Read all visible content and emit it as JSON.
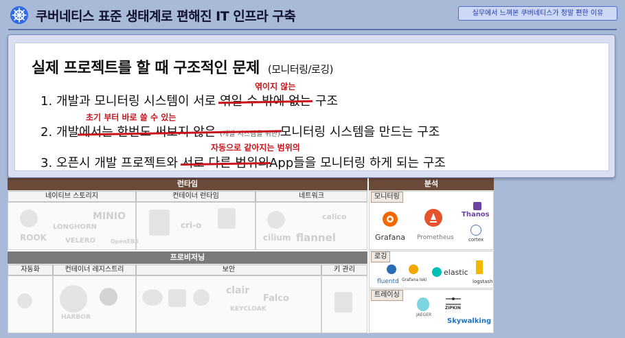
{
  "header": {
    "title": "쿠버네티스 표준 생태계로 편해진 IT 인프라 구축",
    "badge": "실무에서 느껴본 쿠버네티스가 정말 편한 이유",
    "logo_icon": "kubernetes-helm-icon"
  },
  "popup": {
    "title": "실제 프로젝트를 할 때 구조적인 문제",
    "subtitle": "(모니터링/로깅)",
    "lines": [
      {
        "num": "1.",
        "before": "개발과 모니터링 시스템이 서로",
        "struck": "엮일 수 밖에 없는",
        "after": "구조",
        "note": "엮이지 않는"
      },
      {
        "num": "2.",
        "before": "개발",
        "struck": "에서는 한번도 써보지 않은",
        "struck_small": "(개발 시스템을 위한)",
        "after": "모니터링 시스템을 만드는 구조",
        "note": "초기 부터 바로 쓸 수 있는"
      },
      {
        "num": "3.",
        "before": "오픈시 개발 프로젝트와",
        "struck": "서로 다른 범위의",
        "after": "App들을 모니터링 하게 되는 구조",
        "note": "자동으로 같아지는 범위의"
      }
    ]
  },
  "diagram": {
    "runtime": "런타임",
    "analysis": "분석",
    "runtime_cols": [
      "네이티브 스토리지",
      "컨테이너 런타임",
      "네트워크"
    ],
    "storage_logos": [
      "ROOK",
      "LONGHORN",
      "MINIO",
      "VELERO",
      "OpenEBS"
    ],
    "runtime_logos": [
      "cri-o"
    ],
    "network_logos": [
      "cilium",
      "flannel",
      "calico"
    ],
    "provisioning": "프로비저닝",
    "prov_cols": [
      "자동화",
      "컨테이너 레지스트리",
      "보안",
      "키 관리"
    ],
    "prov_logos": [
      "HARBOR",
      "clair",
      "Falco",
      "KEYCLOAK"
    ],
    "monitoring": "모니터링",
    "monitoring_logos": [
      "Grafana",
      "Prometheus",
      "Thanos",
      "cortex"
    ],
    "logging": "로깅",
    "logging_logos": [
      "fluentd",
      "Grafana loki",
      "elastic",
      "logstash"
    ],
    "tracing": "트레이싱",
    "tracing_logos": [
      "JAEGER",
      "ZIPKIN",
      "Skywalking"
    ]
  }
}
